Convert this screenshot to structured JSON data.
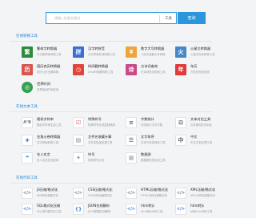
{
  "search": {
    "placeholder": "请输入检索关键词",
    "scope": "工具",
    "button": "查询"
  },
  "sections": [
    {
      "title": "在线转换工具",
      "tools": [
        {
          "name": "繁体字转换器",
          "desc": "中文繁简体转换工具",
          "icon": "traditional-chinese-icon",
          "color": "#2e8b3a"
        },
        {
          "name": "汉字转拼音",
          "desc": "汉字拼音在线转换工具",
          "icon": "pinyin-icon",
          "color": "#3b6fcf"
        },
        {
          "name": "数字大写转换器",
          "desc": "人民币金额大写转换",
          "icon": "currency-icon",
          "color": "#f0a53a"
        },
        {
          "name": "火星文转换器",
          "desc": "火星文在线转换工具",
          "icon": "martian-text-icon",
          "color": "#4a87c7"
        },
        {
          "name": "国历农历转换器",
          "desc": "农历公历日期转换",
          "icon": "calendar-icon",
          "color": "#d9534f"
        },
        {
          "name": "时间戳转换器",
          "desc": "Unix时间戳转换工具",
          "icon": "timestamp-icon",
          "color": "#e3443a"
        },
        {
          "name": "古诗词查询",
          "desc": "古诗词在线查询工具",
          "icon": "poetry-icon",
          "color": "#c94a86"
        },
        {
          "name": "年历",
          "desc": "万年历在线查询",
          "icon": "yearly-calendar-icon",
          "color": "#e23a3a"
        },
        {
          "name": "世界时间",
          "desc": "世界各地时间查询",
          "icon": "world-time-icon",
          "color": "#35a04f"
        }
      ]
    },
    {
      "title": "在线文本工具",
      "tools": [
        {
          "name": "随机字符串",
          "desc": "随机字符串生成工具",
          "icon": "random-string-icon",
          "color": "#9aa3ad"
        },
        {
          "name": "特殊符号",
          "desc": "特殊符号在线复制使用",
          "icon": "checkbox-icon",
          "color": "#3a3a3a"
        },
        {
          "name": "字数统计",
          "desc": "在线统计文字字数",
          "icon": "word-count-icon",
          "color": "#555f6b"
        },
        {
          "name": "文本对比工具",
          "desc": "文本差异在线对比",
          "icon": "text-compare-icon",
          "color": "#4b5866"
        },
        {
          "name": "金角火卷转换器",
          "desc": "文字排版转换工具",
          "icon": "text-convert-icon",
          "color": "#2a70c9"
        },
        {
          "name": "文件名收藏计算",
          "desc": "文件名批量处理工具",
          "icon": "file-name-icon",
          "color": "#7b8794"
        },
        {
          "name": "文字排序",
          "desc": "文本行在线排序工具",
          "icon": "text-sort-icon",
          "color": "#4a5563"
        },
        {
          "name": "中文",
          "desc": "中文文本处理工具",
          "icon": "chinese-text-icon",
          "color": "#5a6471"
        },
        {
          "name": "名人名言",
          "desc": "名人名言在线查询",
          "icon": "quote-icon",
          "color": "#2f86d6"
        },
        {
          "name": "符号",
          "desc": "常用符号大全",
          "icon": "symbol-icon",
          "color": "#8a94a0"
        },
        {
          "name": "数据源",
          "desc": "数据源在线生成工具",
          "icon": "data-source-icon",
          "color": "#9aa3ad"
        }
      ]
    },
    {
      "title": "在线代码工具",
      "tools": [
        {
          "name": "JS压缩/格式化",
          "desc": "JS代码压缩格式化",
          "icon": "js-format-icon",
          "color": "#6b7886"
        },
        {
          "name": "CSS压缩/格式化",
          "desc": "CSS代码压缩格式化",
          "icon": "css-format-icon",
          "color": "#6b7886"
        },
        {
          "name": "HTML压缩/格式化",
          "desc": "HTML代码压缩格式化",
          "icon": "html-format-icon",
          "color": "#6b7886"
        },
        {
          "name": "XML压缩/格式化",
          "desc": "XML代码压缩格式化",
          "icon": "xml-format-icon",
          "color": "#6b7886"
        },
        {
          "name": "SQL格式化压缩",
          "desc": "SQL语句格式化工具",
          "icon": "sql-format-icon",
          "color": "#3a7bd5"
        },
        {
          "name": "JSON在线解析",
          "desc": "JSON数据在线解析",
          "icon": "json-icon",
          "color": "#3a7bd5"
        },
        {
          "name": "html转js",
          "desc": "html转js代码工具",
          "icon": "html-to-js-icon",
          "color": "#3a7bd5"
        },
        {
          "name": "html转js",
          "desc": "js转html代码工具",
          "icon": "js-to-html-icon",
          "color": "#3a7bd5"
        }
      ]
    }
  ]
}
